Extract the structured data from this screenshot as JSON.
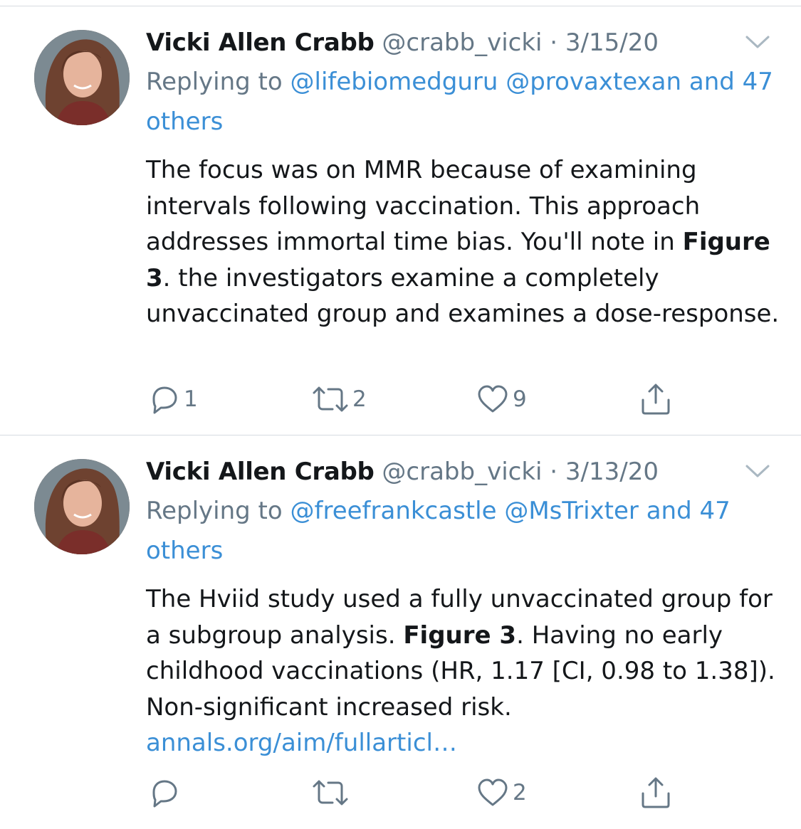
{
  "tweets": [
    {
      "author_name": "Vicki Allen Crabb",
      "handle": "@crabb_vicki",
      "date": "· 3/15/20",
      "replying_prefix": "Replying to",
      "replying_handle_1": "@lifebiomedguru",
      "replying_handle_2": "@provaxtexan",
      "replying_and": "and",
      "replying_others": "47 others",
      "text_1": "The focus was on MMR because of examining intervals following vaccination. This approach addresses immortal time bias. You'll note in",
      "text_bold": "Figure 3",
      "text_2": ". the investigators examine a completely unvaccinated group and examines a dose-response.",
      "reply_count": "1",
      "retweet_count": "2",
      "like_count": "9"
    },
    {
      "author_name": "Vicki Allen Crabb",
      "handle": "@crabb_vicki",
      "date": "· 3/13/20",
      "replying_prefix": "Replying to",
      "replying_handle_1": "@freefrankcastle",
      "replying_handle_2": "@MsTrixter",
      "replying_and": "and 47",
      "replying_others": "others",
      "text_1": "The Hviid study used a fully unvaccinated group for a subgroup analysis.",
      "text_bold": "Figure 3",
      "text_2": ". Having no early childhood vaccinations (HR, 1.17 [CI, 0.98 to 1.38]). Non-significant increased risk.",
      "link_text": "annals.org/aim/fullarticl…",
      "reply_count": "",
      "retweet_count": "",
      "like_count": "2"
    }
  ],
  "icons": [
    "chevron-down-icon",
    "reply-icon",
    "retweet-icon",
    "like-icon",
    "share-icon"
  ],
  "colors": {
    "link": "#3b8fd6",
    "meta": "#657786",
    "text": "#14171a",
    "divider": "#d6dbe0"
  }
}
